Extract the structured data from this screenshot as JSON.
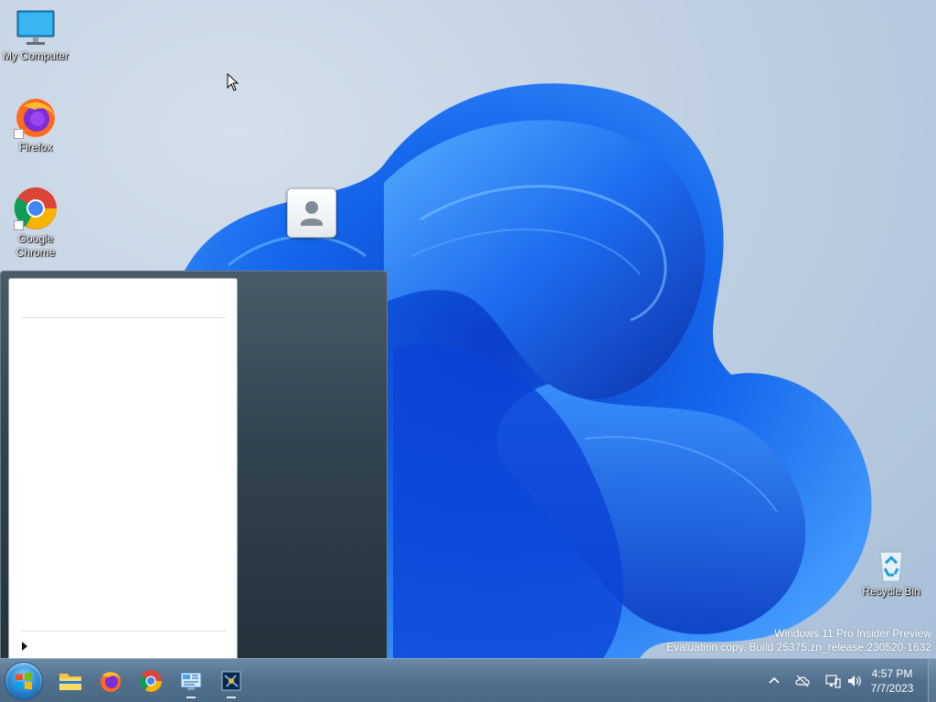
{
  "desktop": {
    "icons": [
      {
        "label": "My Computer",
        "icon": "monitor-icon"
      },
      {
        "label": "Firefox",
        "icon": "firefox-icon"
      },
      {
        "label": "Google Chrome",
        "icon": "chrome-icon"
      },
      {
        "label": "Recycle Bin",
        "icon": "recycle-bin-icon"
      }
    ],
    "watermark": {
      "line1": "Windows 11 Pro Insider Preview",
      "line2": "Evaluation copy. Build 25375.zn_release.230520-1632"
    }
  },
  "start_menu": {
    "user_picture_icon": "user-avatar-icon",
    "all_programs_icon": "arrow-right-icon"
  },
  "taskbar": {
    "start_icon": "windows-orb-icon",
    "pinned": [
      {
        "name": "File Explorer",
        "icon": "folder-icon",
        "running": false
      },
      {
        "name": "Firefox",
        "icon": "firefox-icon",
        "running": false
      },
      {
        "name": "Google Chrome",
        "icon": "chrome-icon",
        "running": false
      },
      {
        "name": "Control Panel",
        "icon": "control-panel-icon",
        "running": true
      },
      {
        "name": "App",
        "icon": "app-window-icon",
        "running": true
      }
    ],
    "tray": {
      "icons": [
        "chevron-up-icon",
        "cloud-offline-icon",
        "network-icon",
        "volume-icon"
      ],
      "time": "4:57 PM",
      "date": "7/7/2023"
    }
  },
  "colors": {
    "taskbar": "#52708d",
    "start_menu_right": "#324350",
    "wallpaper_accent": "#1a5ee8"
  }
}
